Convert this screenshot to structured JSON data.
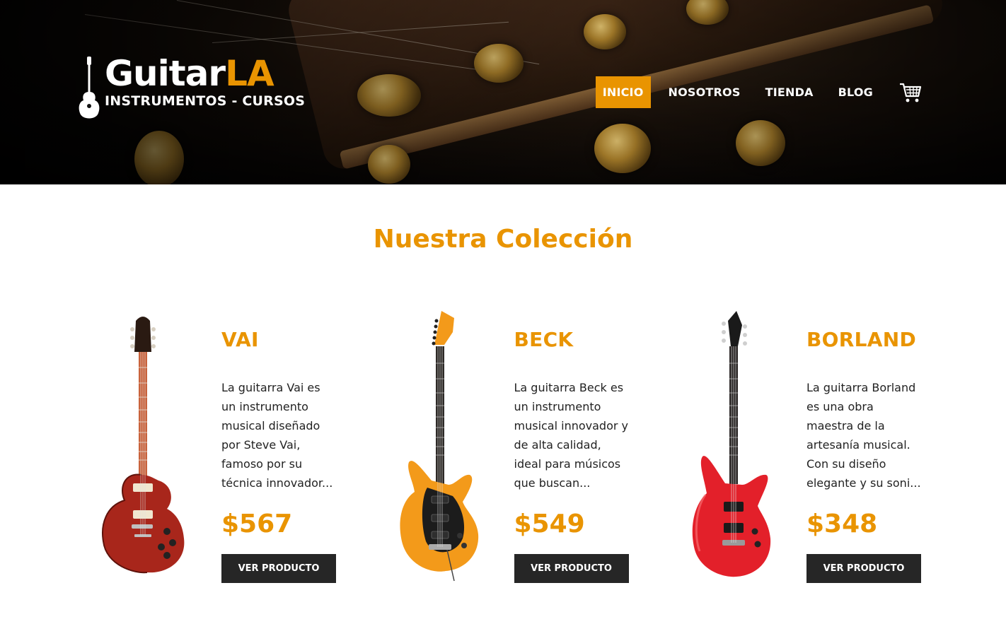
{
  "header": {
    "logo": {
      "title_main": "Guitar",
      "title_accent": "LA",
      "subtitle": "INSTRUMENTOS - CURSOS"
    },
    "nav": {
      "items": [
        {
          "label": "INICIO",
          "active": true
        },
        {
          "label": "NOSOTROS",
          "active": false
        },
        {
          "label": "TIENDA",
          "active": false
        },
        {
          "label": "BLOG",
          "active": false
        }
      ],
      "cart_icon": "cart-icon"
    }
  },
  "main": {
    "title": "Nuestra Colección",
    "products": [
      {
        "name": "VAI",
        "description": "La guitarra Vai es un instrumento musical diseñado por Steve Vai, famoso por su técnica innovador...",
        "price": "$567",
        "button": "VER PRODUCTO",
        "body_color": "#a8261b"
      },
      {
        "name": "BECK",
        "description": "La guitarra Beck es un instrumento musical innovador y de alta calidad, ideal para músicos que buscan...",
        "price": "$549",
        "button": "VER PRODUCTO",
        "body_color": "#f39a1a"
      },
      {
        "name": "BORLAND",
        "description": "La guitarra Borland es una obra maestra de la artesanía musical. Con su diseño elegante y su soni...",
        "price": "$348",
        "button": "VER PRODUCTO",
        "body_color": "#e3202a"
      }
    ]
  },
  "colors": {
    "accent": "#e99401",
    "dark_button": "#262626"
  }
}
